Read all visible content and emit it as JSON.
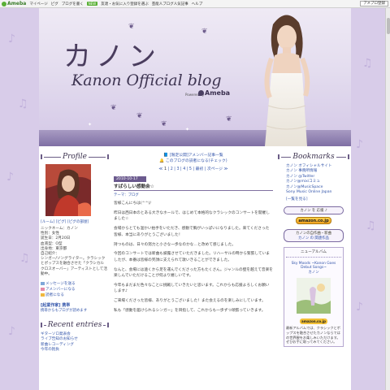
{
  "topbar": {
    "logo": "Ameba",
    "links": [
      "マイページ",
      "ピグ",
      "ブログを書く"
    ],
    "badge": "NEW",
    "notice": "友達・お気に入り登録を選ぶ",
    "promo": "芸能人ブログ人気記事",
    "extra": "ヘルプ",
    "button": "アメブロ登録"
  },
  "header": {
    "title": "カノン",
    "subtitle": "Kanon Official blog",
    "powered": "Powered by",
    "ameba": "Ameba"
  },
  "sidebar_left": {
    "profile_head": "Profile",
    "profile_links": "[ルーム] [ピグ] [ピグの部屋]",
    "profile_text": [
      "ニックネーム：カノン",
      "性別：女性",
      "誕生日：2月20日",
      "血液型：O型",
      "出身地：東京都",
      "自己紹介：",
      "シンガー/ソングライター。クラシック",
      "とポップスを融合させた「クラシカル",
      "クロスオーバー」アーティストとして活動中。"
    ],
    "actions": [
      "メッセージを送る",
      "アメンバーになる",
      "読者になる"
    ],
    "mobile_title": "[起業作家] 携帯",
    "mobile_sub": "携帯からもブログが読めます",
    "recent_head": "Recent entries",
    "recent": [
      "ギターソロ発表会",
      "ライブ告知のお知らせ",
      "新曲レコーディング",
      "今年の抱負"
    ]
  },
  "main": {
    "notice1": "[限定公開]アメンバー記事一覧",
    "notice2": "このブログの読者になる(チェック)",
    "pager_prefix": "≪",
    "pages": [
      "1",
      "2",
      "3",
      "4",
      "5"
    ],
    "current_page": "1",
    "pager_label": "最初",
    "pager_next": "次ページ ≫",
    "date": "2010-10-17",
    "entry_title": "すばらしい感動会☆",
    "theme": "テーマ：ブログ",
    "paragraphs": [
      "皆様こんにちは(^^)/",
      "昨日は西日本のとある大きなホールで、はじめて本格的なクラシックのコンサートを開催しました☆",
      "会場からとても温かい拍手をいただき、感動で胸がいっぱいになりました。来てくださった皆様、本当にありがとうございました！",
      "持つものは、日々の努力と小さな一歩なのかな…と改めて感じました。",
      "今回のコンサートでは新曲も披露させていただきました。リハーサルの時から緊張していましたが、本番は皆様の笑顔に支えられて歌いきることができました。",
      "なんと、会場には遠くから足を運んでくださった方もたくさん。ジャンルの壁を越えて音楽を楽しんでいただけることが何より嬉しいです。",
      "今年もまだまだ色々なことに挑戦していきたいと思います。これからも応援よろしくお願いします♪",
      "ご来場くださった皆様、ありがとうございました！また会えるのを楽しみにしています。",
      "私も「感動を届けられるシンガー」を目指して、これからも一歩ずつ頑張っていきます。"
    ]
  },
  "sidebar_right": {
    "bookmarks_head": "Bookmarks",
    "links": [
      "カノン オフィシャルサイト",
      "カノン 事務所情報",
      "カノン @Twitter",
      "カノン@mixiコミュ",
      "カノン@MusicSpace",
      "Sony Music Online Japan"
    ],
    "list": [
      "[一覧を見る]"
    ],
    "pill1": "カノン を 応援 ♪",
    "amazon": "amazon.co.jp",
    "pill2": "カノンの自作曲・新曲",
    "pill2_sub": "カノン の 関連作品",
    "album_title": "ニューアルバム",
    "album_name": "Sky Moods ~Kanon Goes Debut Songs~",
    "album_artist": "カノン",
    "amz_small": "amazon.co.jp",
    "desc": "最新アルバムでは、クラシックとポップスを融合させたカノンならではの世界観をお楽しみいただけます。ぜひお手に取ってみてください。"
  }
}
